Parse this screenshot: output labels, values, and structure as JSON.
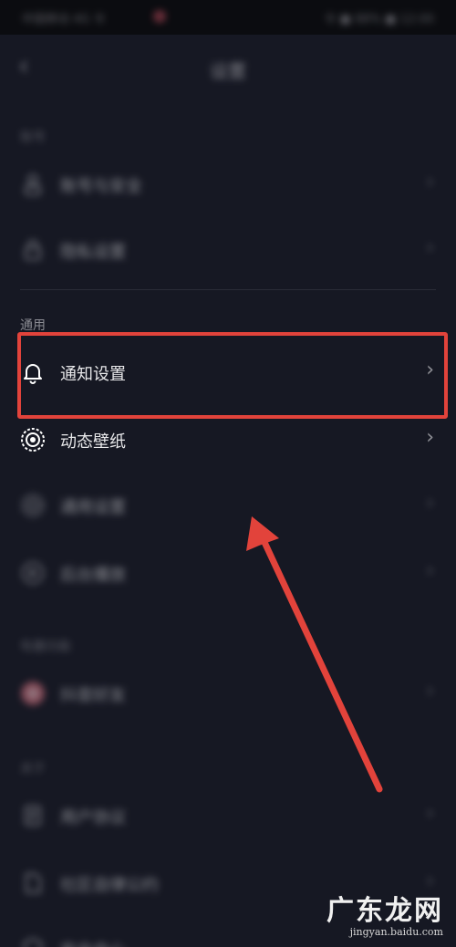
{
  "status_bar": {
    "carrier": "中国移动 4G 令",
    "time": "令 ■ 88% ■ 12:00"
  },
  "nav": {
    "back_icon": "chevron-left-icon",
    "title": "设置"
  },
  "sections": {
    "account_label": "账号",
    "general_label": "通用",
    "fun_label": "有趣功能",
    "about_label": "关于"
  },
  "rows": {
    "account_security": "账号与安全",
    "privacy": "隐私设置",
    "notifications": "通知设置",
    "live_wallpaper": "动态壁纸",
    "general_settings": "通用设置",
    "background_play": "后台播放",
    "dou_friends": "抖音好友",
    "user_agreement": "用户协议",
    "community_norms": "社区自律公约",
    "safety_center": "安全中心"
  },
  "icons": {
    "notifications": "bell-icon",
    "live_wallpaper": "target-icon",
    "general_settings": "gear-icon"
  },
  "watermark": {
    "brand": "广东龙网",
    "url": "jingyan.baidu.com"
  },
  "colors": {
    "background": "#161823",
    "highlight": "#e2433b"
  }
}
